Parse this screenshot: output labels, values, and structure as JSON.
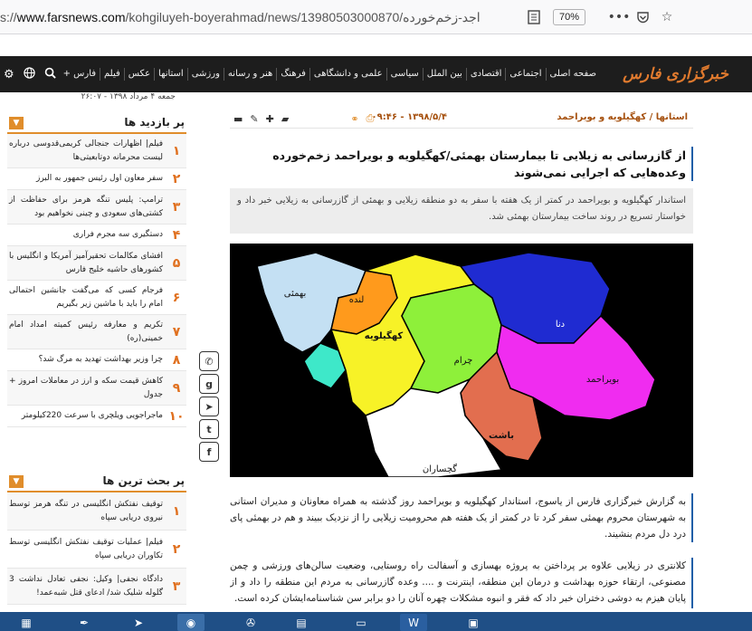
{
  "browser": {
    "url_prefix": "s://",
    "url_host": "www.farsnews.com",
    "url_path": "/kohgiluyeh-boyerahmad/news/13980503000870/",
    "url_tail": "اجد-زخم‌خورده",
    "zoom": "70%",
    "icons": [
      "reader-icon",
      "more-icon",
      "pocket-icon",
      "bookmark-star-icon"
    ]
  },
  "site": {
    "logo": "خبرگزاری فارس",
    "menu": [
      "صفحه اصلی",
      "اجتماعی",
      "اقتصادی",
      "بین الملل",
      "سیاسی",
      "علمی و دانشگاهی",
      "فرهنگ",
      "هنر و رسانه",
      "ورزشی",
      "استانها",
      "عکس",
      "فیلم",
      "فارس +"
    ],
    "date": "جمعه ۴ مرداد ۱۳۹۸ - ۲۶:۰۷"
  },
  "article": {
    "breadcrumb": "استانها / کهگیلویه و بویراحمد",
    "datetime": "۱۳۹۸/۵/۴ - ۰۹:۴۶",
    "headline": "از گازرسانی به زیلایی تا بیمارستان بهمئی/کهگیلویه و بویراحمد زخم‌خورده وعده‌هایی که اجرایی نمی‌شوند",
    "lead": "استاندار کهگیلویه و بویراحمد در کمتر از یک هفته با سفر به دو منطقه زیلایی و بهمئی از گازرسانی به زیلایی خبر داد و خواستار تسریع در روند ساخت بیمارستان بهمئی شد.",
    "para1": "به گزارش خبرگزاری فارس از یاسوج، استاندار کهگیلویه و بویراحمد روز گذشته به همراه معاونان و مدیران استانی به شهرستان محروم بهمئی سفر کرد تا در کمتر از یک هفته هم محرومیت زیلایی را از نزدیک ببیند و هم در بهمئی پای درد دل مردم بنشیند.",
    "para2": "کلانتری در زیلایی علاوه بر پرداختن به پروژه بهسازی و آسفالت راه روستایی، وضعیت سالن‌های ورزشی و چمن مصنوعی، ارتقاء حوزه بهداشت و درمان این منطقه، اینترنت و .... وعده گازرسانی به مردم این منطقه را داد و از پایان هیزم به دوشی دختران خبر داد که فقر و انبوه مشکلات چهره آنان را دو برابر سن شناسنامه‌ایشان کرده است."
  },
  "map": {
    "regions": [
      {
        "name": "بهمئی",
        "color": "#c4e0f3"
      },
      {
        "name": "لنده",
        "color": "#ff9a1c"
      },
      {
        "name": "کهگیلویه",
        "color": "#f7f227"
      },
      {
        "name": "چرام",
        "color": "#8ef03a"
      },
      {
        "name": "دنا",
        "color": "#1f2bd1"
      },
      {
        "name": "بویراحمد",
        "color": "#f02cf0"
      },
      {
        "name": "باشت",
        "color": "#e26e4f"
      },
      {
        "name": "گچساران",
        "color": "#ffffff"
      }
    ],
    "teal_region_color": "#3ee8c9"
  },
  "sidebar": {
    "most_viewed": {
      "title": "پر بازدید ها",
      "items": [
        {
          "num": "۱",
          "text": "فیلم| اظهارات جنجالی کریمی‌قدوسی درباره لیست محرمانه دوتابعیتی‌ها"
        },
        {
          "num": "۲",
          "text": "سفر معاون اول رئیس جمهور به البرز"
        },
        {
          "num": "۳",
          "text": "ترامپ: پلیس تنگه هرمز برای حفاظت از کشتی‌های سعودی و چینی نخواهیم بود"
        },
        {
          "num": "۴",
          "text": "دستگیری سه مجرم فراری"
        },
        {
          "num": "۵",
          "text": "افشای مکالمات تحقیرآمیز آمریکا و انگلیس با کشورهای حاشیه خلیج فارس"
        },
        {
          "num": "۶",
          "text": "فرجام کسی که می‌گفت جانشین احتمالی امام را باید با ماشین زیر بگیریم"
        },
        {
          "num": "۷",
          "text": "تکریم و معارفه رئیس کمیته امداد امام خمینی(ره)"
        },
        {
          "num": "۸",
          "text": "چرا وزیر بهداشت تهدید به مرگ شد؟"
        },
        {
          "num": "۹",
          "text": "کاهش قیمت سکه و ارز در معاملات امروز + جدول"
        },
        {
          "num": "۱۰",
          "text": "ماجراجویی ویلچری با سرعت 220کیلومتر"
        }
      ]
    },
    "most_discussed": {
      "title": "پر بحث ترین ها",
      "items": [
        {
          "num": "۱",
          "text": "توقیف نفتکش انگلیسی در تنگه هرمز توسط نیروی دریایی سپاه"
        },
        {
          "num": "۲",
          "text": "فیلم| عملیات توقیف نفتکش انگلیسی توسط تکاوران دریایی سپاه"
        },
        {
          "num": "۳",
          "text": "دادگاه نجفی| وکیل: نجفی تعادل نداشت 3 گلوله شلیک شد/ ادعای قتل شبه‌عمد!"
        }
      ]
    }
  }
}
